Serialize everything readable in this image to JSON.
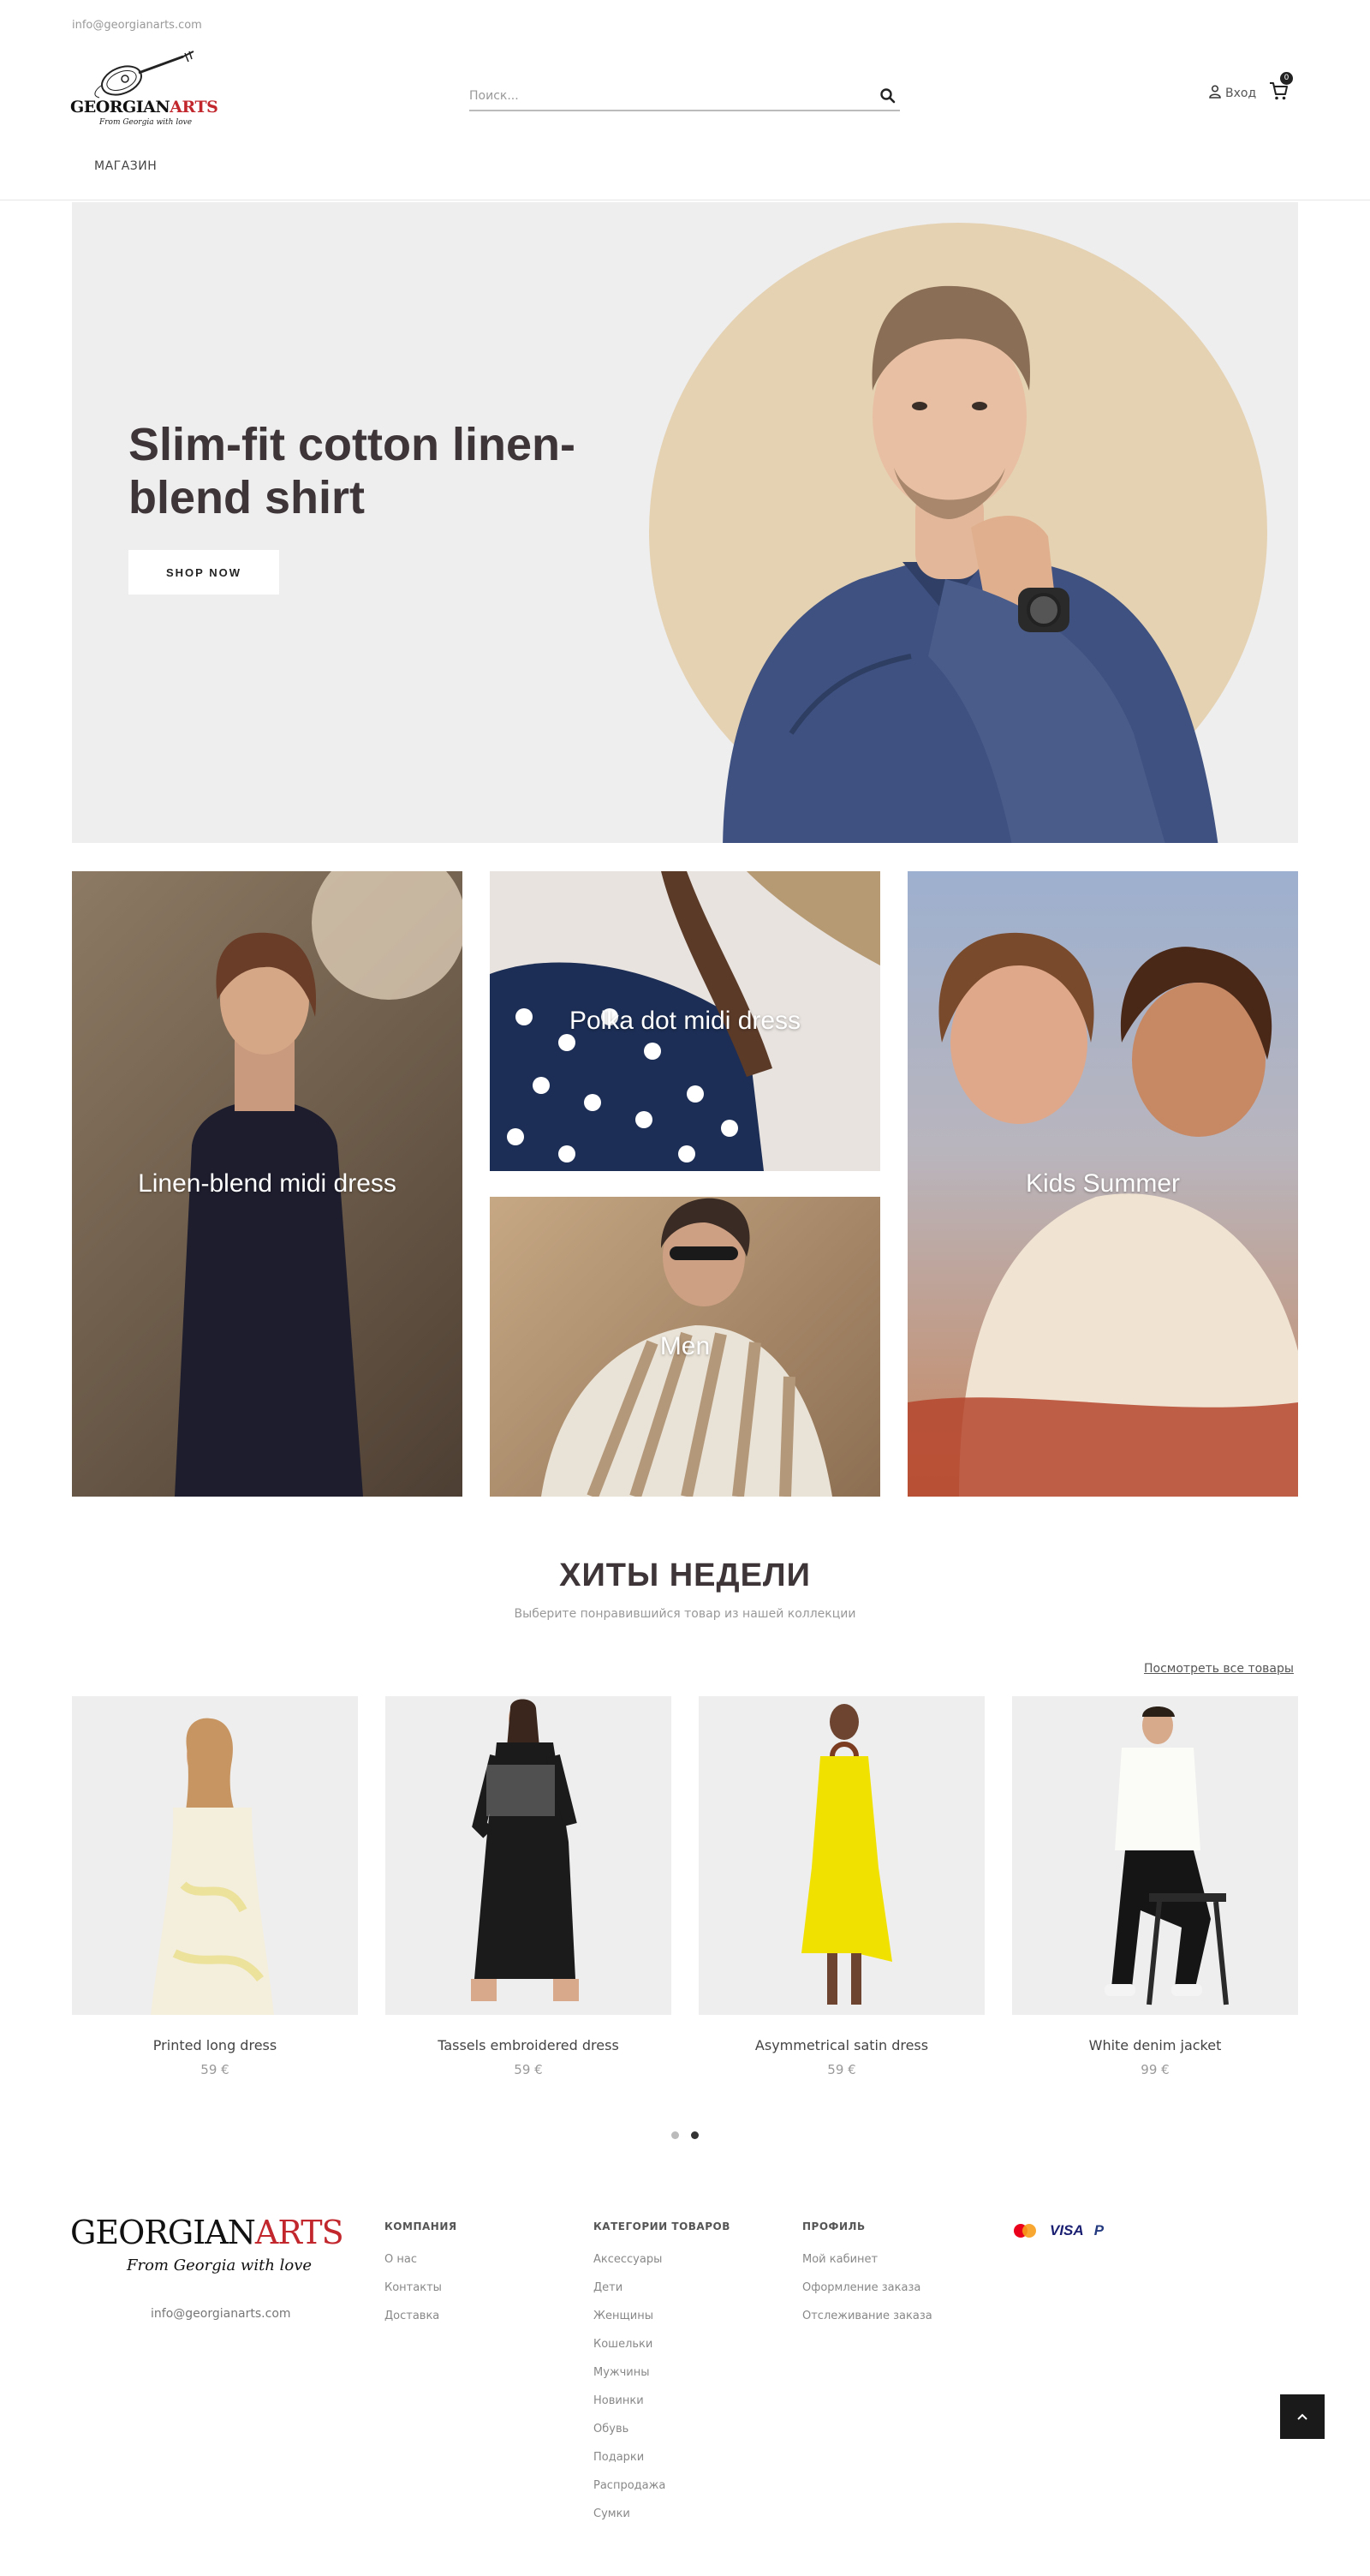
{
  "topbar": {
    "email": "info@georgianarts.com"
  },
  "header": {
    "logo": {
      "brand_black": "GEORGIAN",
      "brand_red": "ARTS",
      "tagline": "From Georgia with love"
    },
    "search": {
      "placeholder": "Поиск...",
      "icon": "search-icon"
    },
    "login_label": "Вход",
    "cart": {
      "icon": "cart-icon",
      "count": "0"
    },
    "nav": [
      "МАГАЗИН"
    ]
  },
  "hero": {
    "title": "Slim-fit cotton linen-blend shirt",
    "button_label": "SHOP NOW",
    "colors": {
      "background": "#eeeeef",
      "circle": "#e5d2b3",
      "title": "#3d3537"
    }
  },
  "categories": [
    {
      "label": "Linen-blend midi dress"
    },
    {
      "label": "Polka dot midi dress"
    },
    {
      "label": "Men"
    },
    {
      "label": "Kids Summer"
    }
  ],
  "bestsellers": {
    "title": "ХИТЫ НЕДЕЛИ",
    "subtitle": "Выберите понравившийся товар из нашей коллекции",
    "view_all": "Посмотреть все товары",
    "products": [
      {
        "name": "Printed long dress",
        "price": "59 €"
      },
      {
        "name": "Tassels embroidered dress",
        "price": "59 €"
      },
      {
        "name": "Asymmetrical satin dress",
        "price": "59 €"
      },
      {
        "name": "White denim jacket",
        "price": "99 €"
      }
    ],
    "slider": {
      "pages": 2,
      "active": 2
    }
  },
  "footer": {
    "logo": {
      "brand_black": "GEORGIAN",
      "brand_red": "ARTS",
      "tagline": "From Georgia with love"
    },
    "email": "info@georgianarts.com",
    "columns": [
      {
        "title": "КОМПАНИЯ",
        "links": [
          "О нас",
          "Контакты",
          "Доставка"
        ]
      },
      {
        "title": "КАТЕГОРИИ ТОВАРОВ",
        "links": [
          "Аксессуары",
          "Дети",
          "Женщины",
          "Кошельки",
          "Мужчины",
          "Новинки",
          "Обувь",
          "Подарки",
          "Распродажа",
          "Сумки"
        ]
      },
      {
        "title": "ПРОФИЛЬ",
        "links": [
          "Мой кабинет",
          "Оформление заказа",
          "Отслеживание заказа"
        ]
      }
    ],
    "payments": [
      {
        "icon": "mastercard-icon"
      },
      {
        "icon": "visa-icon",
        "label": "VISA"
      },
      {
        "icon": "paypal-icon",
        "label": "P"
      }
    ],
    "back_to_top_icon": "chevron-up-icon"
  },
  "colors": {
    "accent_red": "#c1272d",
    "text_dark": "#3d3537",
    "muted": "#999999"
  }
}
